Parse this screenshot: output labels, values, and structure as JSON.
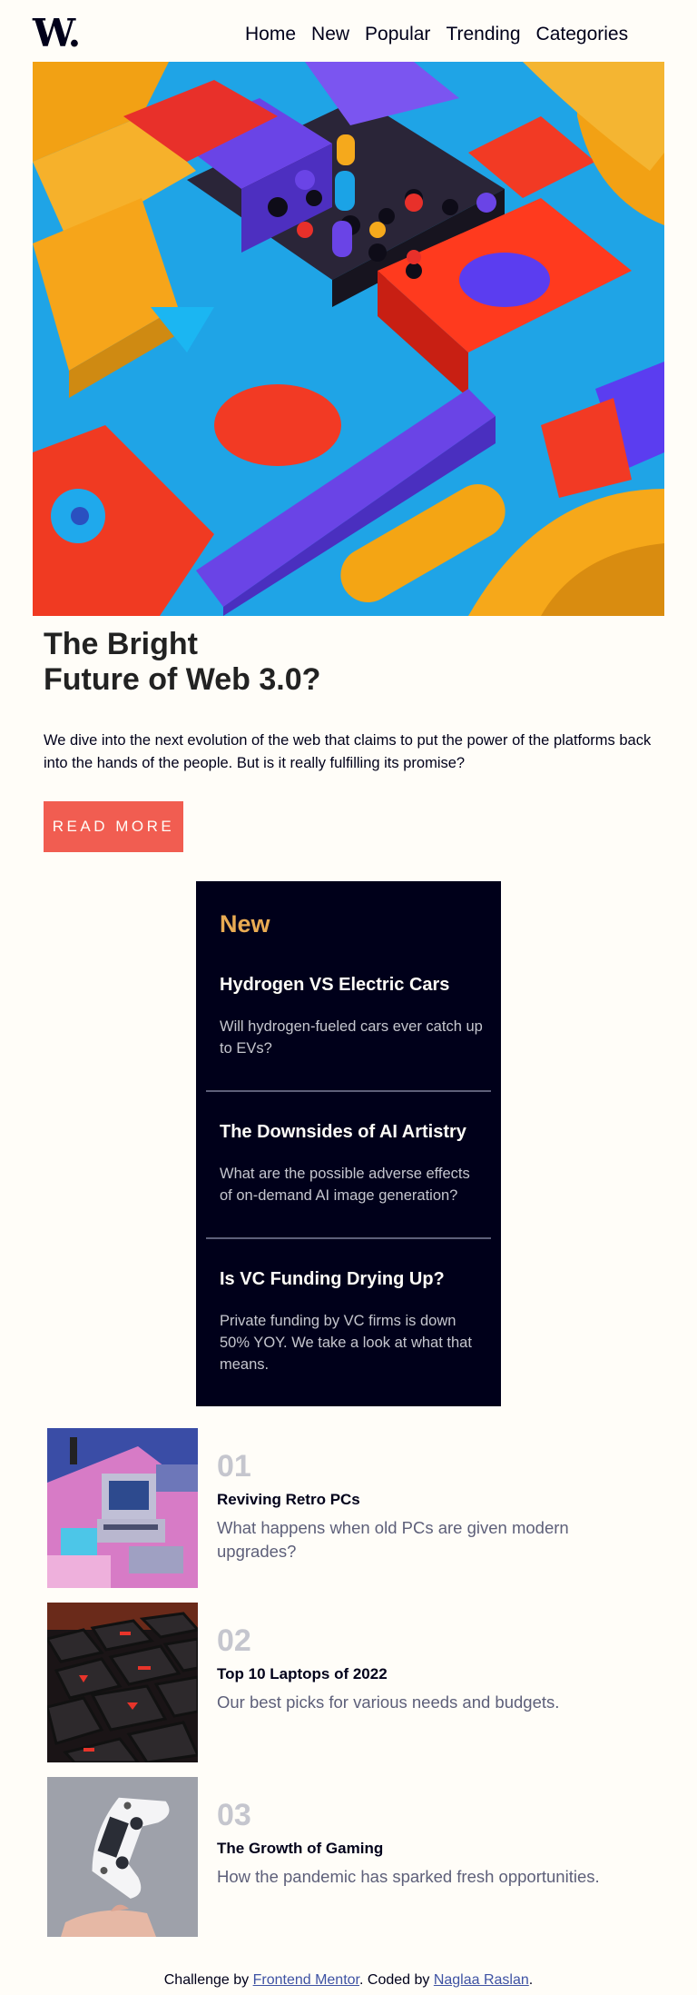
{
  "header": {
    "logo": "W.",
    "nav": [
      "Home",
      "New",
      "Popular",
      "Trending",
      "Categories"
    ]
  },
  "hero": {
    "title_line1": "The Bright",
    "title_line2": "Future of Web 3.0?",
    "description": "We dive into the next evolution of the web that claims to put the power of the platforms back into the hands of the people. But is it really fulfilling its promise?",
    "button_label": "READ MORE"
  },
  "new_section": {
    "heading": "New",
    "items": [
      {
        "title": "Hydrogen VS Electric Cars",
        "desc": "Will hydrogen-fueled cars ever catch up to EVs?"
      },
      {
        "title": "The Downsides of AI Artistry",
        "desc": "What are the possible adverse effects of on-demand AI image generation?"
      },
      {
        "title": "Is VC Funding Drying Up?",
        "desc": "Private funding by VC firms is down 50% YOY. We take a look at what that means."
      }
    ]
  },
  "trending": [
    {
      "num": "01",
      "title": "Reviving Retro PCs",
      "desc": "What happens when old PCs are given modern upgrades?"
    },
    {
      "num": "02",
      "title": "Top 10 Laptops of 2022",
      "desc": "Our best picks for various needs and budgets."
    },
    {
      "num": "03",
      "title": "The Growth of Gaming",
      "desc": "How the pandemic has sparked fresh opportunities."
    }
  ],
  "footer": {
    "prefix": "Challenge by ",
    "link1": "Frontend Mentor",
    "middle": ". Coded by ",
    "link2": "Naglaa Raslan",
    "suffix": "."
  },
  "colors": {
    "accent_red": "#f15d51",
    "accent_orange": "#e9ab53",
    "dark_navy": "#00001a",
    "cream": "#fffdf8",
    "grey_blue": "#5d5f79"
  }
}
